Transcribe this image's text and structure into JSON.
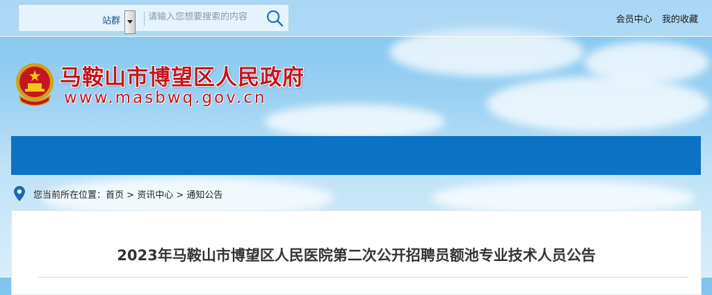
{
  "topbar": {
    "site_select_label": "站群",
    "search_placeholder": "请输入您想要搜索的内容",
    "user_links": [
      "会员中心",
      "我的收藏"
    ]
  },
  "header": {
    "site_name": "马鞍山市博望区人民政府",
    "site_domain": "www.masbwq.gov.cn"
  },
  "breadcrumb": {
    "prefix": "您当前所在位置：",
    "items": [
      "首页",
      "资讯中心",
      "通知公告"
    ],
    "separator": " > "
  },
  "article": {
    "title": "2023年马鞍山市博望区人民医院第二次公开招聘员额池专业技术人员公告"
  },
  "colors": {
    "nav_blue": "#0b72c4",
    "brand_red": "#c4161c",
    "search_icon": "#1f6fbf"
  },
  "icons": {
    "search": "search-icon",
    "location": "location-pin-icon",
    "emblem": "national-emblem-icon"
  }
}
